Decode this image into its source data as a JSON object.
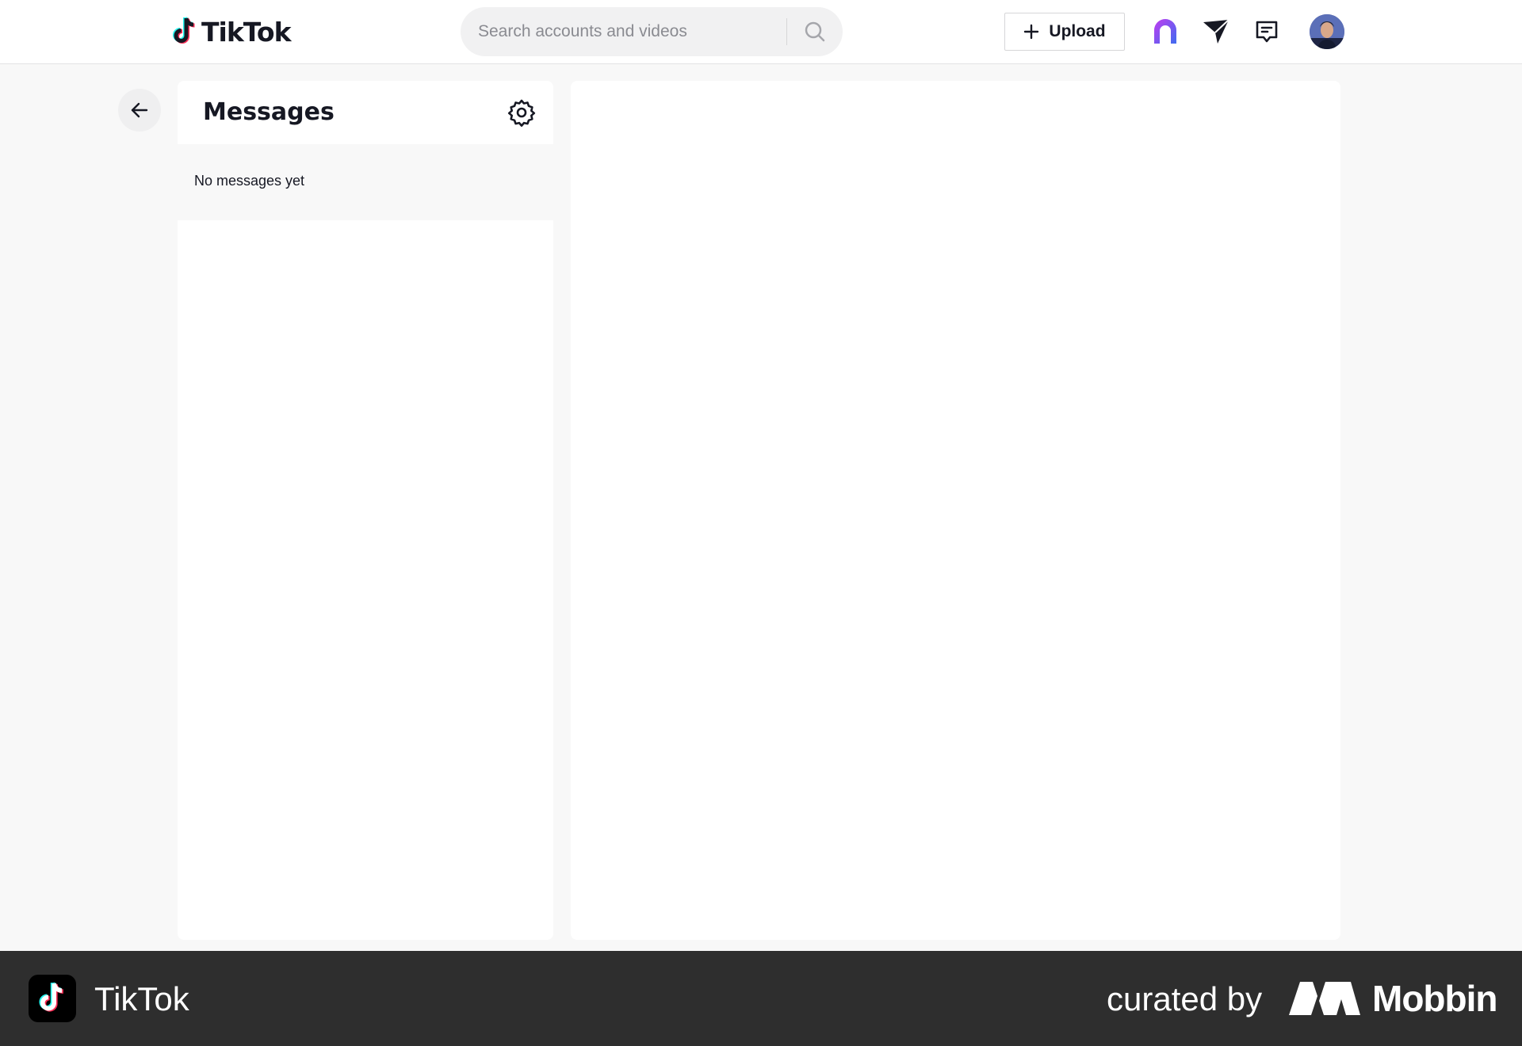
{
  "header": {
    "logo_text": "TikTok",
    "search": {
      "placeholder": "Search accounts and videos",
      "value": ""
    },
    "upload_label": "Upload",
    "icons": [
      "tiktok-now-icon",
      "send-icon",
      "inbox-icon"
    ]
  },
  "messages": {
    "title": "Messages",
    "empty_text": "No messages yet"
  },
  "footer": {
    "app_name": "TikTok",
    "curated_by": "curated by",
    "brand": "Mobbin"
  },
  "colors": {
    "page_background": "#f8f8f8",
    "panel_background": "#ffffff",
    "text": "#161823",
    "footer_background": "#2e2e2e",
    "brand_cyan": "#25f4ee",
    "brand_red": "#fe2c55"
  }
}
